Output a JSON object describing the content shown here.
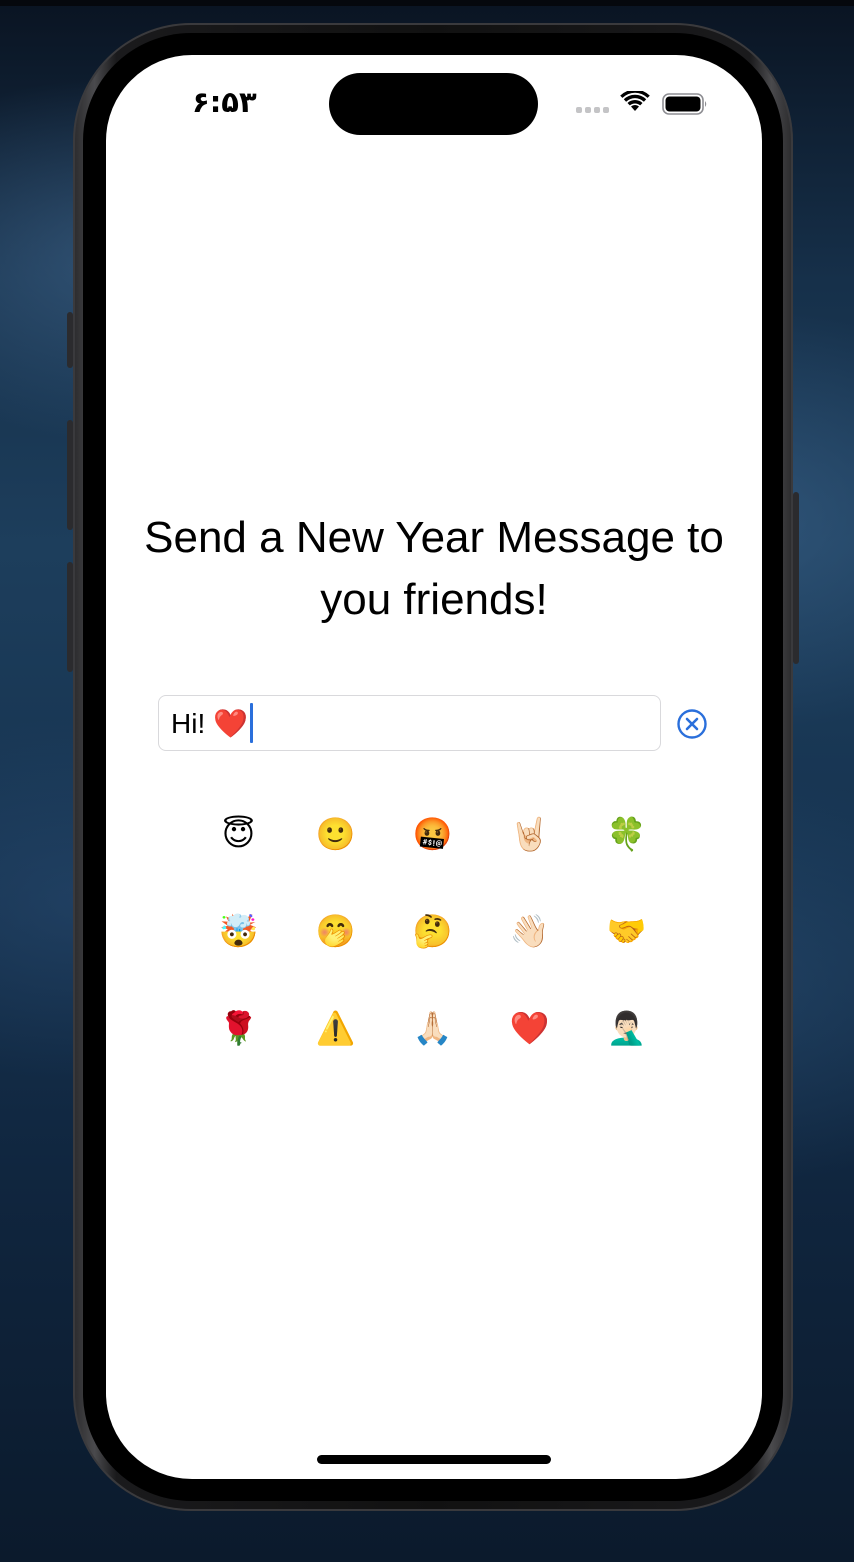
{
  "status_bar": {
    "time": "۶:۵۳",
    "signal_icon": "cellular-signal-icon",
    "wifi_icon": "wifi-icon",
    "battery_icon": "battery-icon"
  },
  "main": {
    "title": "Send a New Year Message to you friends!",
    "message_field": {
      "value": "Hi! ❤️",
      "clear_icon": "clear-circle-icon"
    },
    "emojis": [
      "😇",
      "🙂",
      "🤬",
      "🤘🏻",
      "🍀",
      "🤯",
      "🤭",
      "🤔",
      "👋🏻",
      "🤝",
      "🌹",
      "⚠️",
      "🙏🏻",
      "❤️",
      "🤦🏻‍♂️"
    ]
  },
  "colors": {
    "accent": "#2a6fdb",
    "screen_background": "#ffffff",
    "field_border": "#d9d9dc"
  }
}
